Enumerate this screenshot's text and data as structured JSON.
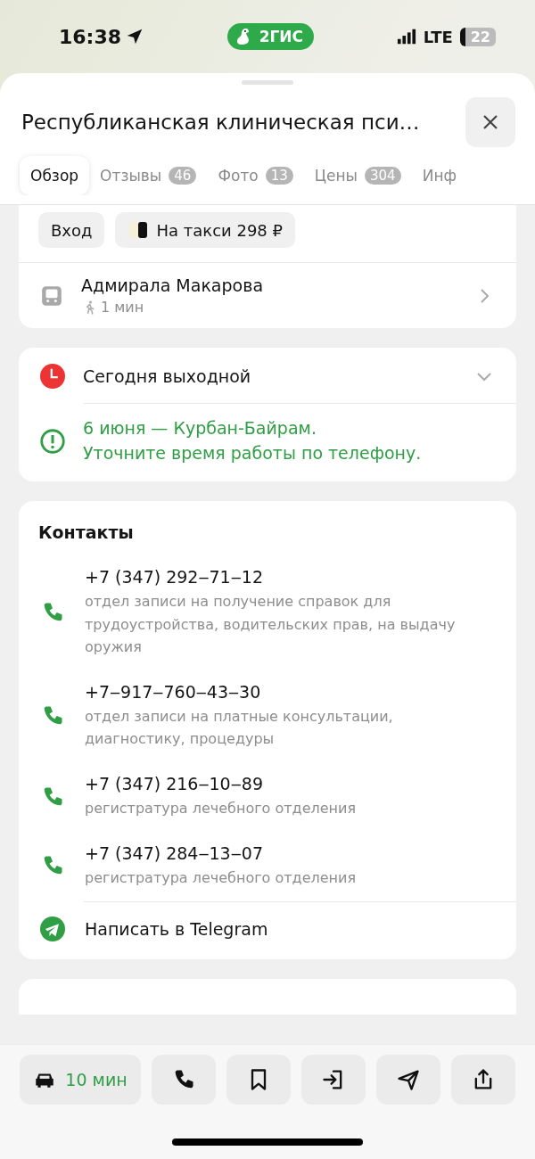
{
  "status_bar": {
    "time": "16:38",
    "app_badge": "2ГИС",
    "network": "LTE",
    "battery": "22"
  },
  "header": {
    "title": "Республиканская клиническая пси…"
  },
  "tabs": [
    {
      "label": "Обзор",
      "selected": true
    },
    {
      "label": "Отзывы",
      "count": "46",
      "selected": false
    },
    {
      "label": "Фото",
      "count": "13",
      "selected": false
    },
    {
      "label": "Цены",
      "count": "304",
      "selected": false
    },
    {
      "label": "Инф",
      "selected": false
    }
  ],
  "quick_actions": [
    {
      "label": "Вход",
      "kind": "entrance"
    },
    {
      "label": "На такси 298 ₽",
      "kind": "taxi"
    }
  ],
  "transit": {
    "stop": "Адмирала Макарова",
    "walk_time": "1 мин"
  },
  "hours": {
    "status": "Сегодня выходной",
    "expanded": false,
    "notice": [
      "6 июня — Курбан-Байрам.",
      "Уточните время работы по телефону."
    ]
  },
  "contacts": {
    "title": "Контакты",
    "phones": [
      {
        "number": "+7 (347) 292‒71‒12",
        "note": "отдел записи на получение справок для трудоустройства, водительских прав, на выдачу оружия"
      },
      {
        "number": "+7‒917‒760‒43‒30",
        "note": "отдел записи на платные консультации, диагностику, процедуры"
      },
      {
        "number": "+7 (347) 216‒10‒89",
        "note": "регистратура лечебного отделения"
      },
      {
        "number": "+7 (347) 284‒13‒07",
        "note": "регистратура лечебного отделения"
      }
    ],
    "telegram": "Написать в Telegram"
  },
  "bottom_bar": {
    "route": "10 мин",
    "actions": [
      {
        "kind": "call"
      },
      {
        "kind": "bookmark"
      },
      {
        "kind": "entrance"
      },
      {
        "kind": "send"
      },
      {
        "kind": "share"
      }
    ]
  }
}
